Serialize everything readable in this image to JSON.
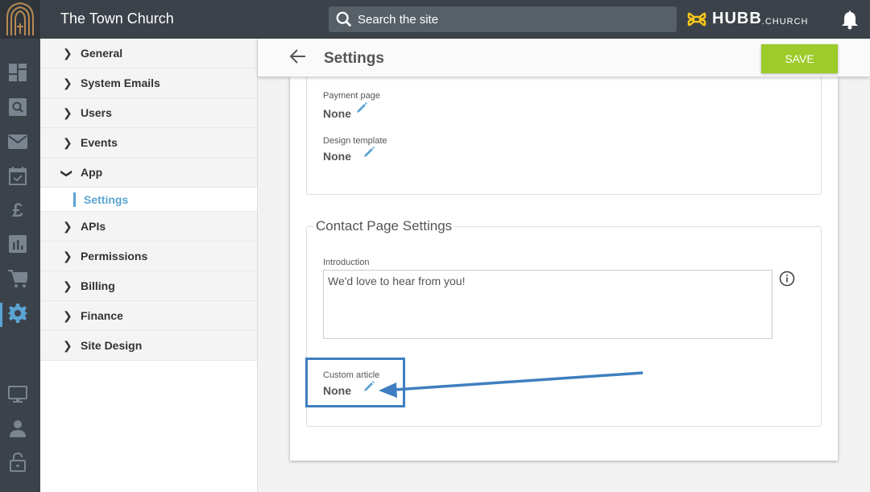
{
  "topbar": {
    "site_title": "The Town Church",
    "search_placeholder": "Search the site",
    "brand_word": "HUBB",
    "brand_suffix": ".CHURCH"
  },
  "colors": {
    "accent": "#5ba4d3",
    "save": "#9ccb2a",
    "annotation": "#3f7fc1",
    "topbar": "#3b4249"
  },
  "leftnav": {
    "icons": [
      "dashboard-icon",
      "search-icon",
      "mail-icon",
      "calendar-check-icon",
      "pound-icon",
      "bar-chart-icon",
      "cart-icon",
      "gear-icon",
      "monitor-icon",
      "person-icon",
      "unlock-icon"
    ],
    "active": "gear-icon"
  },
  "sidepanel": {
    "items": [
      {
        "label": "General",
        "expanded": false
      },
      {
        "label": "System Emails",
        "expanded": false
      },
      {
        "label": "Users",
        "expanded": false
      },
      {
        "label": "Events",
        "expanded": false
      },
      {
        "label": "App",
        "expanded": true
      },
      {
        "label": "APIs",
        "expanded": false
      },
      {
        "label": "Permissions",
        "expanded": false
      },
      {
        "label": "Billing",
        "expanded": false
      },
      {
        "label": "Finance",
        "expanded": false
      },
      {
        "label": "Site Design",
        "expanded": false
      }
    ],
    "sub_item": "Settings"
  },
  "header": {
    "title": "Settings",
    "save_label": "SAVE"
  },
  "section1": {
    "fields": [
      {
        "label": "Payment page",
        "value": "None"
      },
      {
        "label": "Design template",
        "value": "None"
      }
    ]
  },
  "section2": {
    "legend": "Contact Page Settings",
    "intro_label": "Introduction",
    "intro_value": "We'd love to hear from you!",
    "custom_label": "Custom article",
    "custom_value": "None"
  }
}
